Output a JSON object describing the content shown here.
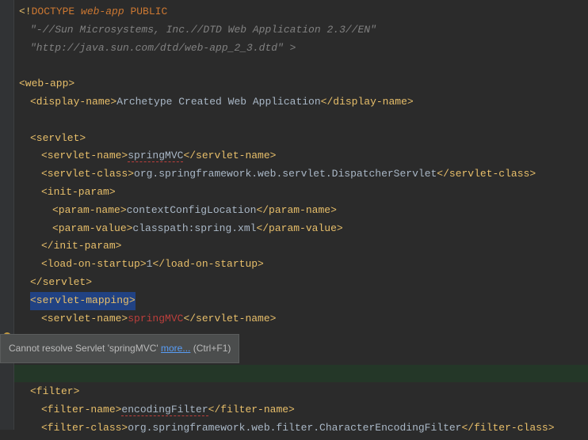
{
  "doctype": {
    "openBang": "<!",
    "keyword": "DOCTYPE",
    "root": "web-app",
    "pub": "PUBLIC",
    "line2": "\"-//Sun Microsystems, Inc.//DTD Web Application 2.3//EN\"",
    "line3": "\"http://java.sun.com/dtd/web-app_2_3.dtd\" >"
  },
  "tags": {
    "webapp_open": "<web-app>",
    "displayname_open": "<display-name>",
    "displayname_close": "</display-name>",
    "displayname_text": "Archetype Created Web Application",
    "servlet_open": "<servlet>",
    "servlet_close": "</servlet>",
    "servletname_open": "<servlet-name>",
    "servletname_close": "</servlet-name>",
    "servletname_text1": "springMVC",
    "servletclass_open": "<servlet-class>",
    "servletclass_close": "</servlet-class>",
    "servletclass_text": "org.springframework.web.servlet.DispatcherServlet",
    "initparam_open": "<init-param>",
    "initparam_close": "</init-param>",
    "paramname_open": "<param-name>",
    "paramname_close": "</param-name>",
    "paramname_text": "contextConfigLocation",
    "paramvalue_open": "<param-value>",
    "paramvalue_close": "</param-value>",
    "paramvalue_text": "classpath:spring.xml",
    "loadonstartup_open": "<load-on-startup>",
    "loadonstartup_close": "</load-on-startup>",
    "loadonstartup_text": "1",
    "servletmapping_open": "<servlet-mapping>",
    "servletname_text2": "springMVC",
    "filter_open": "<filter>",
    "filtername_open": "<filter-name>",
    "filtername_close": "</filter-name>",
    "filtername_text": "encodingFilter",
    "filterclass_open": "<filter-class>",
    "filterclass_close": "</filter-class>",
    "filterclass_text": "org.springframework.web.filter.CharacterEncodingFilter"
  },
  "tooltip": {
    "text_prefix": "Cannot resolve Servlet '",
    "text_name": "springMVC",
    "text_suffix": "' ",
    "link": "more...",
    "shortcut": " (Ctrl+F1)"
  }
}
